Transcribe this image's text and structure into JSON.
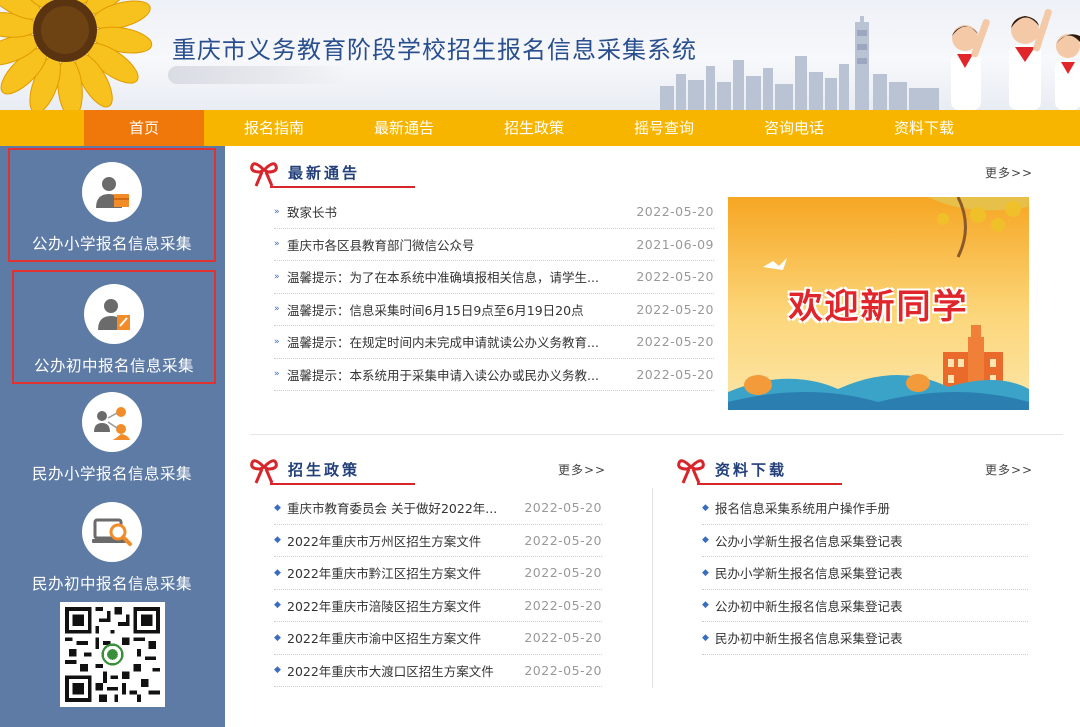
{
  "header": {
    "title": "重庆市义务教育阶段学校招生报名信息采集系统"
  },
  "nav": {
    "items": [
      {
        "label": "首页",
        "active": true
      },
      {
        "label": "报名指南"
      },
      {
        "label": "最新通告"
      },
      {
        "label": "招生政策"
      },
      {
        "label": "摇号查询"
      },
      {
        "label": "咨询电话"
      },
      {
        "label": "资料下载"
      }
    ]
  },
  "sidebar": {
    "items": [
      {
        "label": "公办小学报名信息采集",
        "icon": "user-box-icon"
      },
      {
        "label": "公办初中报名信息采集",
        "icon": "user-edit-icon"
      },
      {
        "label": "民办小学报名信息采集",
        "icon": "users-network-icon"
      },
      {
        "label": "民办初中报名信息采集",
        "icon": "laptop-search-icon"
      }
    ]
  },
  "notices": {
    "title": "最新通告",
    "more": "更多>>",
    "items": [
      {
        "text": "致家长书",
        "date": "2022-05-20"
      },
      {
        "text": "重庆市各区县教育部门微信公众号",
        "date": "2021-06-09"
      },
      {
        "text": "温馨提示：为了在本系统中准确填报相关信息，请学生...",
        "date": "2022-05-20"
      },
      {
        "text": "温馨提示：信息采集时间6月15日9点至6月19日20点",
        "date": "2022-05-20"
      },
      {
        "text": "温馨提示：在规定时间内未完成申请就读公办义务教育...",
        "date": "2022-05-20"
      },
      {
        "text": "温馨提示：本系统用于采集申请入读公办或民办义务教...",
        "date": "2022-05-20"
      }
    ]
  },
  "banner": {
    "text": "欢迎新同学"
  },
  "policy": {
    "title": "招生政策",
    "more": "更多>>",
    "items": [
      {
        "text": "重庆市教育委员会 关于做好2022年...",
        "date": "2022-05-20"
      },
      {
        "text": "2022年重庆市万州区招生方案文件",
        "date": "2022-05-20"
      },
      {
        "text": "2022年重庆市黔江区招生方案文件",
        "date": "2022-05-20"
      },
      {
        "text": "2022年重庆市涪陵区招生方案文件",
        "date": "2022-05-20"
      },
      {
        "text": "2022年重庆市渝中区招生方案文件",
        "date": "2022-05-20"
      },
      {
        "text": "2022年重庆市大渡口区招生方案文件",
        "date": "2022-05-20"
      }
    ]
  },
  "downloads": {
    "title": "资料下载",
    "more": "更多>>",
    "items": [
      {
        "text": "报名信息采集系统用户操作手册"
      },
      {
        "text": "公办小学新生报名信息采集登记表"
      },
      {
        "text": "民办小学新生报名信息采集登记表"
      },
      {
        "text": "公办初中新生报名信息采集登记表"
      },
      {
        "text": "民办初中新生报名信息采集登记表"
      }
    ]
  },
  "colors": {
    "nav_bg": "#f8b500",
    "nav_active": "#f0780a",
    "sidebar_bg": "#5d7ba5",
    "accent_red": "#d7262b",
    "title_blue": "#23407a"
  }
}
